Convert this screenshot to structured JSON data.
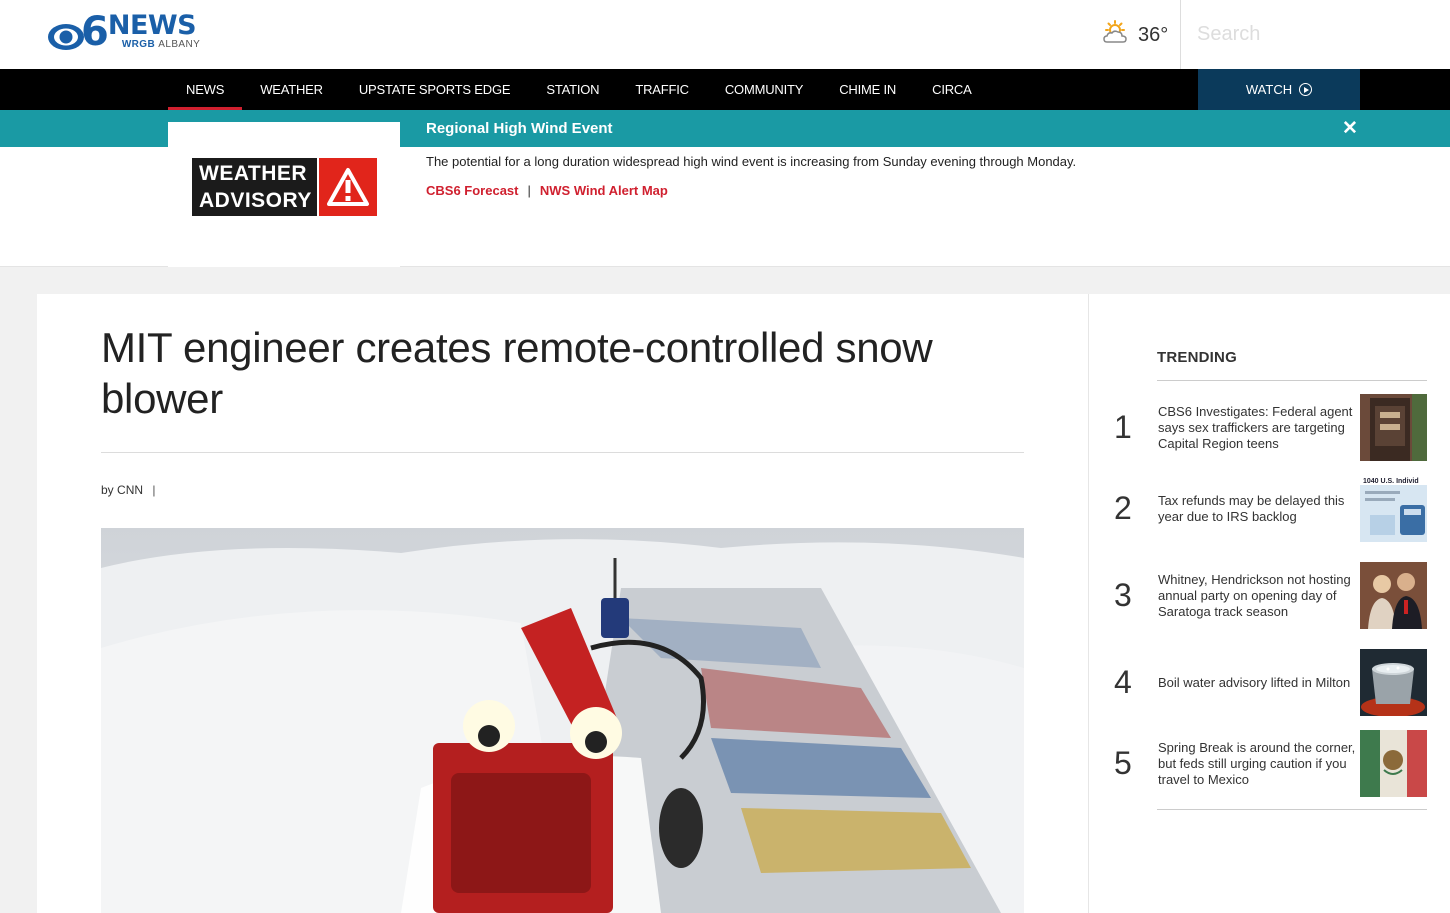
{
  "header": {
    "logo_main": "NEWS",
    "logo_number": "6",
    "logo_call": "WRGB",
    "logo_city": "ALBANY",
    "weather_icon": "partly-cloudy-icon",
    "temperature": "36°",
    "search_placeholder": "Search"
  },
  "nav": {
    "items": [
      {
        "label": "NEWS",
        "active": true
      },
      {
        "label": "WEATHER"
      },
      {
        "label": "UPSTATE SPORTS EDGE"
      },
      {
        "label": "STATION"
      },
      {
        "label": "TRAFFIC"
      },
      {
        "label": "COMMUNITY"
      },
      {
        "label": "CHIME IN"
      },
      {
        "label": "CIRCA"
      }
    ],
    "watch_label": "WATCH",
    "watch_icon": "play-circle-icon",
    "active_color": "#d0202f"
  },
  "alert": {
    "title": "Regional High Wind Event",
    "badge_line1": "WEATHER",
    "badge_line2": "ADVISORY",
    "badge_icon": "warning-triangle-icon",
    "message": "The potential for a long duration widespread high wind event is increasing from Sunday evening through Monday.",
    "links": [
      "CBS6 Forecast",
      "NWS Wind Alert Map"
    ],
    "separator": "|",
    "bar_color": "#1a9aa4"
  },
  "article": {
    "headline": "MIT engineer creates remote-controlled snow blower",
    "byline_prefix": "by",
    "author": "CNN",
    "byline_separator": "|",
    "hero_image": "snow-blower-with-googly-eyes"
  },
  "trending": {
    "title": "TRENDING",
    "items": [
      {
        "rank": "1",
        "title": "CBS6 Investigates: Federal agent says sex traffickers are targeting Capital Region teens",
        "thumb": "door-photo"
      },
      {
        "rank": "2",
        "title": "Tax refunds may be delayed this year due to IRS backlog",
        "thumb": "tax-form-photo"
      },
      {
        "rank": "3",
        "title": "Whitney, Hendrickson not hosting annual party on opening day of Saratoga track season",
        "thumb": "couple-photo"
      },
      {
        "rank": "4",
        "title": "Boil water advisory lifted in Milton",
        "thumb": "boiling-pot-photo"
      },
      {
        "rank": "5",
        "title": "Spring Break is around the corner, but feds still urging caution if you travel to Mexico",
        "thumb": "mexico-flag-photo"
      }
    ]
  }
}
